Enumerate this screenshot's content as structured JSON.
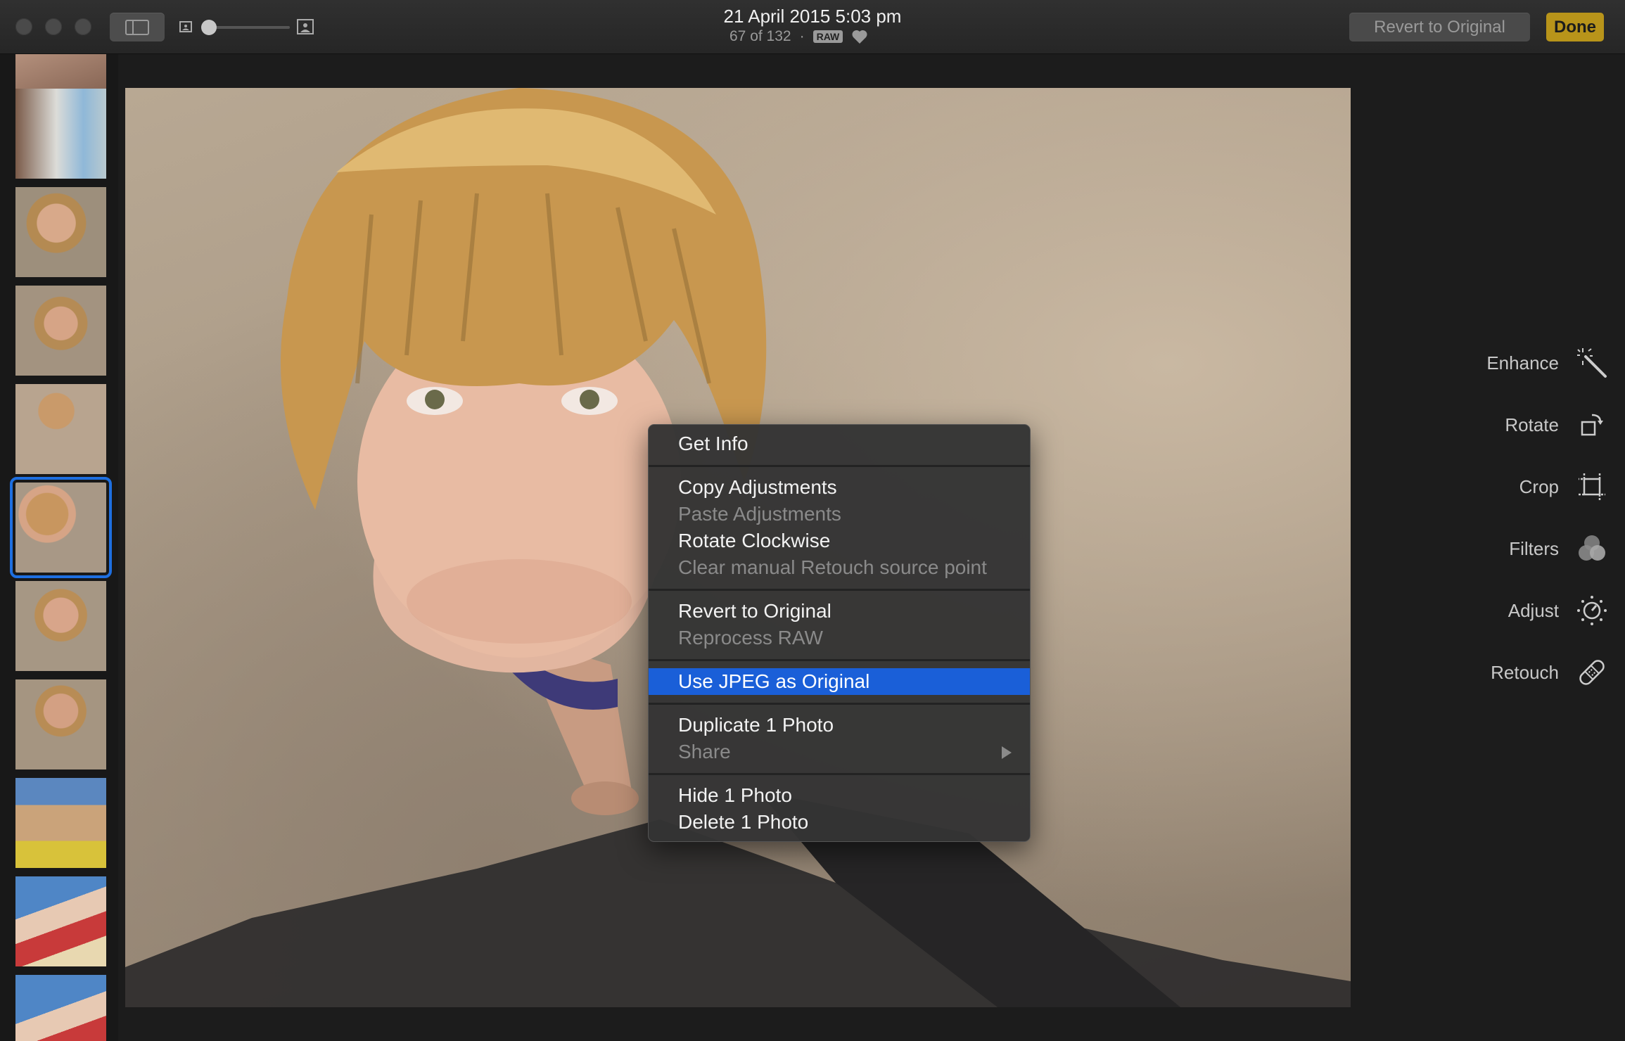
{
  "titlebar": {
    "date": "21 April 2015 5:03 pm",
    "position": "67 of 132",
    "separator": "·",
    "raw_badge": "RAW",
    "revert_label": "Revert to Original",
    "done_label": "Done"
  },
  "filmstrip": {
    "selected_index": 5
  },
  "context_menu": {
    "get_info": "Get Info",
    "copy_adjustments": "Copy Adjustments",
    "paste_adjustments": "Paste Adjustments",
    "rotate_clockwise": "Rotate Clockwise",
    "clear_retouch": "Clear manual Retouch source point",
    "revert_to_original": "Revert to Original",
    "reprocess_raw": "Reprocess RAW",
    "use_jpeg": "Use JPEG as Original",
    "duplicate": "Duplicate 1 Photo",
    "share": "Share",
    "hide": "Hide 1 Photo",
    "delete": "Delete 1 Photo"
  },
  "tools": {
    "enhance": "Enhance",
    "rotate": "Rotate",
    "crop": "Crop",
    "filters": "Filters",
    "adjust": "Adjust",
    "retouch": "Retouch"
  },
  "colors": {
    "accent": "#1a5fd8",
    "done": "#b8941a",
    "selection": "#1e6fe0"
  }
}
